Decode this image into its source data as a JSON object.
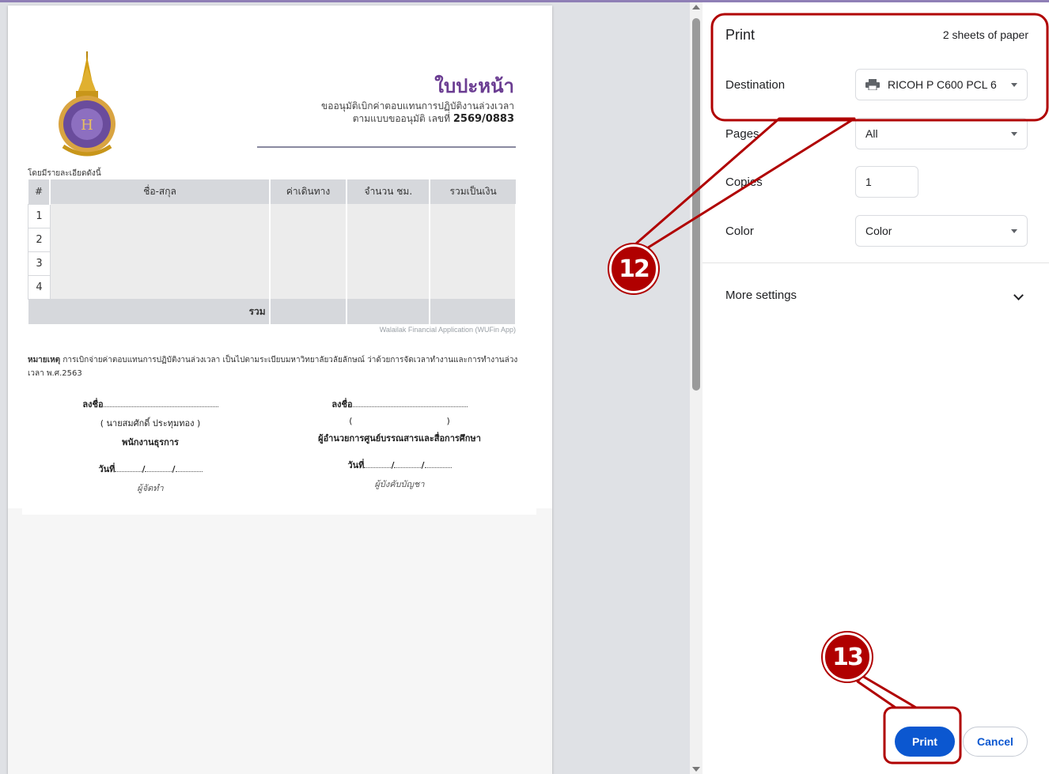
{
  "preview": {
    "document": {
      "title": "ใบปะหน้า",
      "subtitle": "ขออนุมัติเบิกค่าตอบแทนการปฏิบัติงานล่วงเวลา",
      "ref_prefix": "ตามแบบขออนุมัติ เลขที่",
      "ref_number": "2569/0883",
      "detail_label": "โดยมีรายละเอียดดังนี้",
      "table": {
        "headers": [
          "#",
          "ชื่อ-สกุล",
          "ค่าเดินทาง",
          "จำนวน ชม.",
          "รวมเป็นเงิน"
        ],
        "rows": [
          "1",
          "2",
          "3",
          "4"
        ],
        "total_label": "รวม"
      },
      "footer_app": "Walailak Financial Application (WUFin App)",
      "remark_label": "หมายเหตุ",
      "remark_text": "การเบิกจ่ายค่าตอบแทนการปฏิบัติงานล่วงเวลา เป็นไปตามระเบียบมหาวิทยาลัยวลัยลักษณ์ ว่าด้วยการจัดเวลาทำงานและการทำงานล่วงเวลา พ.ศ.2563",
      "signatures": [
        {
          "sign_label": "ลงชื่อ",
          "name": "( นายสมศักดิ์ ประทุมทอง )",
          "role": "พนักงานธุรการ",
          "date_label": "วันที่",
          "caption": "ผู้จัดทำ"
        },
        {
          "sign_label": "ลงชื่อ",
          "name": "(                                  )",
          "role": "ผู้อำนวยการศูนย์บรรณสารและสื่อการศึกษา",
          "date_label": "วันที่",
          "caption": "ผู้บังคับบัญชา"
        }
      ]
    }
  },
  "print_panel": {
    "title": "Print",
    "sheets": "2 sheets of paper",
    "destination_label": "Destination",
    "destination_value": "RICOH P C600 PCL 6",
    "pages_label": "Pages",
    "pages_value": "All",
    "copies_label": "Copies",
    "copies_value": "1",
    "color_label": "Color",
    "color_value": "Color",
    "more_settings": "More settings",
    "print_button": "Print",
    "cancel_button": "Cancel"
  },
  "annotations": {
    "step_a": "12",
    "step_b": "13",
    "highlight_color": "#b00000"
  },
  "colors": {
    "accent": "#0b57d0",
    "title_purple": "#6b3d92"
  }
}
